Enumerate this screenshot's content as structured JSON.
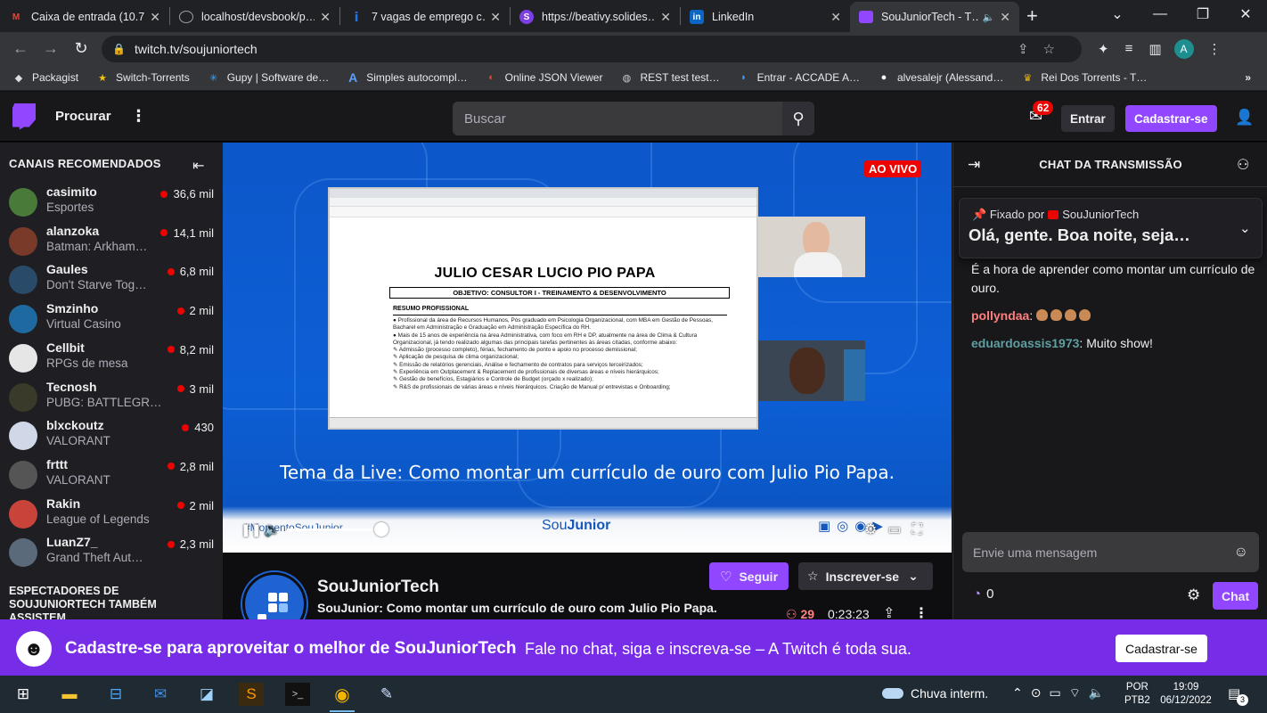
{
  "browser": {
    "tabs": [
      {
        "title": "Caixa de entrada (10.7…",
        "icon": "gmail-icon",
        "color": "#ea4335"
      },
      {
        "title": "localhost/devsbook/p…",
        "icon": "globe-icon",
        "color": "#9aa0a6"
      },
      {
        "title": "7 vagas de emprego c…",
        "icon": "jobs-icon",
        "color": "#1a73e8"
      },
      {
        "title": "https://beativy.solides…",
        "icon": "solides-icon",
        "color": "#7b3fe4"
      },
      {
        "title": "LinkedIn",
        "icon": "linkedin-icon",
        "color": "#0a66c2"
      },
      {
        "title": "SouJuniorTech - T…",
        "icon": "twitch-icon",
        "color": "#9147ff"
      }
    ],
    "url": "twitch.tv/souju­niortech",
    "profile_initial": "A",
    "bookmarks": [
      {
        "label": "Packagist"
      },
      {
        "label": "Switch-Torrents"
      },
      {
        "label": "Gupy | Software de…"
      },
      {
        "label": "Simples autocompl…"
      },
      {
        "label": "Online JSON Viewer"
      },
      {
        "label": "REST test test…"
      },
      {
        "label": "Entrar - ACCADE A…"
      },
      {
        "label": "alvesalejr (Alessand…"
      },
      {
        "label": "Rei Dos Torrents - T…"
      }
    ]
  },
  "twitch": {
    "nav": {
      "browse": "Procurar",
      "search_placeholder": "Buscar",
      "notifications": "62",
      "login": "Entrar",
      "signup": "Cadastrar-se"
    },
    "sidebar": {
      "title": "CANAIS RECOMENDADOS",
      "channels": [
        {
          "name": "casimito",
          "game": "Esportes",
          "viewers": "36,6 mil",
          "color": "#4a7a3a"
        },
        {
          "name": "alanzoka",
          "game": "Batman: Arkham…",
          "viewers": "14,1 mil",
          "color": "#7a3a2a"
        },
        {
          "name": "Gaules",
          "game": "Don't Starve Tog…",
          "viewers": "6,8 mil",
          "color": "#2a4a6a"
        },
        {
          "name": "Smzinho",
          "game": "Virtual Casino",
          "viewers": "2 mil",
          "color": "#1e6aa0"
        },
        {
          "name": "Cellbit",
          "game": "RPGs de mesa",
          "viewers": "8,2 mil",
          "color": "#e6e6e6"
        },
        {
          "name": "Tecnosh",
          "game": "PUBG: BATTLEGR…",
          "viewers": "3 mil",
          "color": "#3a3a2a"
        },
        {
          "name": "blxckoutz",
          "game": "VALORANT",
          "viewers": "430",
          "color": "#d0d8e8"
        },
        {
          "name": "frttt",
          "game": "VALORANT",
          "viewers": "2,8 mil",
          "color": "#555555"
        },
        {
          "name": "Rakin",
          "game": "League of Legends",
          "viewers": "2 mil",
          "color": "#c8443a"
        },
        {
          "name": "LuanZ7_",
          "game": "Grand Theft Aut…",
          "viewers": "2,3 mil",
          "color": "#5a6a7a"
        }
      ],
      "also_watch": "ESPECTADORES DE SOUJUNIORTECH TAMBÉM ASSISTEM"
    },
    "video": {
      "live_badge": "AO VIVO",
      "doc_name": "JULIO CESAR LUCIO PIO PAPA",
      "doc_objective": "OBJETIVO: CONSULTOR I - TREINAMENTO & DESENVOLVIMENTO",
      "doc_section": "RESUMO PROFISSIONAL",
      "doc_lines": [
        "● Profissional da área de Recursos Humanos, Pós graduado em Psicologia Organizacional, com MBA em Gestão de Pessoas, Bacharel em Administração e Graduação em Administração Específica do RH.",
        "● Mais de 15 anos de experiência na área Administrativa, com foco em RH e DP, atualmente na área de Clima & Cultura Organizacional, já tendo realizado algumas das principais tarefas pertinentes às áreas citadas, conforme abaixo:",
        "✎ Admissão (processo completo), férias, fechamento de ponto e apoio no processo demissional;",
        "✎ Aplicação de pesquisa de clima organizacional;",
        "✎ Emissão de relatórios gerenciais, Análise e fechamento de contratos para serviços terceirizados;",
        "✎ Experiência em Outplacement & Replacement de profissionais de diversas áreas e níveis hierárquicos;",
        "✎ Gestão de benefícios, Estagiários e Controle de Budget (orçado x realizado);",
        "✎ R&S de profissionais de várias áreas e níveis hierárquicos. Criação de Manual p/ entrevistas e Onboarding;"
      ],
      "theme": "Tema da Live: Como montar um currículo de ouro com Julio Pio Papa.",
      "hashtag": "#MomentoSouJunior",
      "brand_a": "Sou",
      "brand_b": "Junior"
    },
    "channel": {
      "name": "SouJuniorTech",
      "title": "SouJunior: Como montar um currículo de ouro com Julio Pio Papa.",
      "follow": "Seguir",
      "subscribe": "Inscrever-se",
      "viewers": "29",
      "uptime": "0:23:23"
    },
    "chat": {
      "title": "CHAT DA TRANSMISSÃO",
      "pinned_by": "Fixado por",
      "pinned_author": "SouJuniorTech",
      "pinned_text": "Olá, gente. Boa noite, seja…",
      "pinned_continuation": "É a hora de aprender como montar um currículo de ouro.",
      "messages": [
        {
          "user": "pollyndaa",
          "color": "#ff7f7f",
          "text": ""
        },
        {
          "user": "eduardoassis1973",
          "color": "#5f9ea0",
          "text": "Muito show!"
        }
      ],
      "input_placeholder": "Envie uma mensagem",
      "points": "0",
      "send": "Chat"
    },
    "banner": {
      "title": "Cadastre-se para aproveitar o melhor de SouJuniorTech",
      "subtitle": "Fale no chat, siga e inscreva-se – A Twitch é toda sua.",
      "button": "Cadastrar-se"
    }
  },
  "taskbar": {
    "weather": "Chuva interm.",
    "lang1": "POR",
    "lang2": "PTB2",
    "time": "19:09",
    "date": "06/12/2022",
    "notifications": "3"
  }
}
